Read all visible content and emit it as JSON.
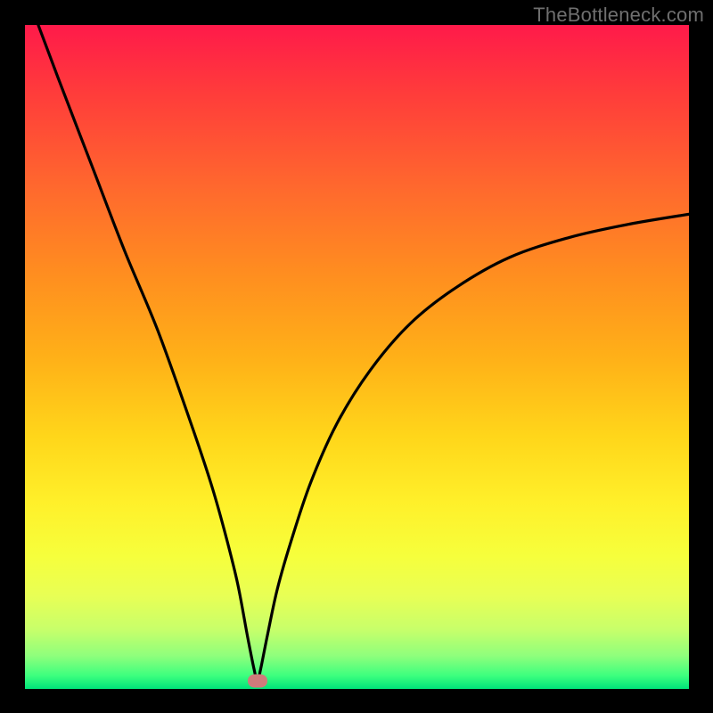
{
  "watermark": "TheBottleneck.com",
  "chart_data": {
    "type": "line",
    "title": "",
    "xlabel": "",
    "ylabel": "",
    "xlim": [
      0,
      100
    ],
    "ylim": [
      0,
      100
    ],
    "series": [
      {
        "name": "curve",
        "x": [
          2,
          5,
          10,
          15,
          20,
          25,
          28,
          30,
          32,
          33.5,
          34.5,
          35,
          35.5,
          36.5,
          38,
          40,
          43,
          47,
          52,
          58,
          65,
          73,
          82,
          91,
          100
        ],
        "y": [
          100,
          92,
          79,
          66,
          54,
          40,
          31,
          24,
          16,
          8,
          3,
          1.2,
          3,
          8,
          15,
          22,
          31,
          40,
          48,
          55,
          60.5,
          65,
          68,
          70,
          71.5
        ]
      }
    ],
    "marker": {
      "x": 35,
      "y": 1.2
    },
    "colors": {
      "curve": "#000000",
      "marker": "#cf7b7b",
      "gradient_top": "#ff1a4a",
      "gradient_bottom": "#00e47a",
      "frame": "#000000"
    }
  }
}
